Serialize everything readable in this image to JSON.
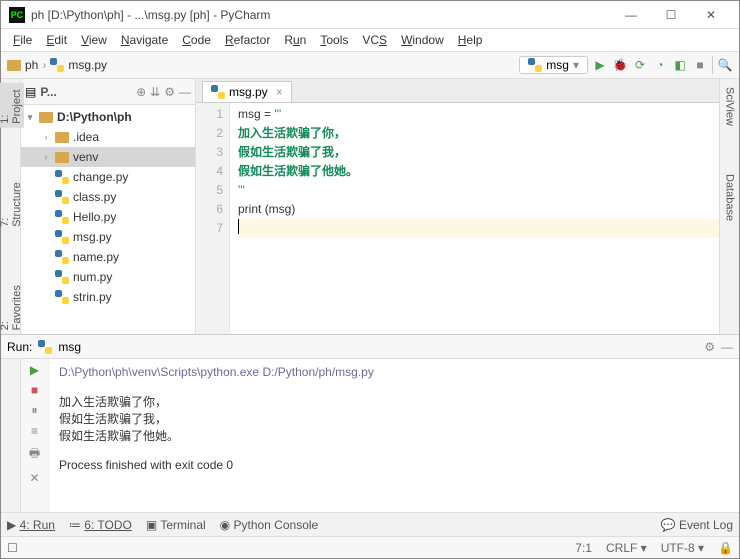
{
  "window": {
    "title": "ph [D:\\Python\\ph] - ...\\msg.py [ph] - PyCharm"
  },
  "menu": [
    "File",
    "Edit",
    "View",
    "Navigate",
    "Code",
    "Refactor",
    "Run",
    "Tools",
    "VCS",
    "Window",
    "Help"
  ],
  "breadcrumb": {
    "root": "ph",
    "file": "msg.py"
  },
  "run_config": {
    "name": "msg"
  },
  "project_panel": {
    "title": "P...",
    "root": "D:\\Python\\ph",
    "folders": [
      ".idea",
      "venv"
    ],
    "files": [
      "change.py",
      "class.py",
      "Hello.py",
      "msg.py",
      "name.py",
      "num.py",
      "strin.py"
    ]
  },
  "left_tabs": [
    "1: Project",
    "7: Structure",
    "2: Favorites"
  ],
  "right_tabs": [
    "SciView",
    "Database"
  ],
  "editor": {
    "tab": "msg.py",
    "lines": {
      "l1a": "msg = ",
      "l1b": "'''",
      "l2": "加入生活欺骗了你，",
      "l3": "假如生活欺骗了我，",
      "l4": "假如生活欺骗了他她。",
      "l5": "'''",
      "l6a": "print ",
      "l6b": "(msg)"
    }
  },
  "run_panel": {
    "title": "Run:",
    "config": "msg",
    "cmd": "D:\\Python\\ph\\venv\\Scripts\\python.exe D:/Python/ph/msg.py",
    "out1": "加入生活欺骗了你，",
    "out2": "假如生活欺骗了我，",
    "out3": "假如生活欺骗了他她。",
    "exit": "Process finished with exit code 0"
  },
  "bottom": {
    "run": "4: Run",
    "todo": "6: TODO",
    "terminal": "Terminal",
    "console": "Python Console",
    "eventlog": "Event Log"
  },
  "status": {
    "pos": "7:1",
    "crlf": "CRLF",
    "enc": "UTF-8",
    "lock": "🔒"
  }
}
